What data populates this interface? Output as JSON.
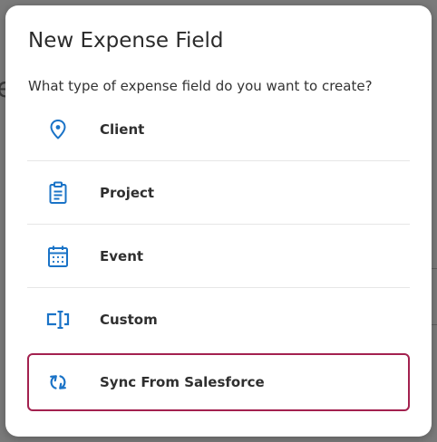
{
  "background": {
    "partial_text": "e"
  },
  "modal": {
    "title": "New Expense Field",
    "prompt": "What type of expense field do you want to create?",
    "accent_color": "#a3214f",
    "icon_color": "#1a73c7",
    "options": [
      {
        "label": "Client",
        "icon": "location-pin-icon",
        "selected": false
      },
      {
        "label": "Project",
        "icon": "clipboard-icon",
        "selected": false
      },
      {
        "label": "Event",
        "icon": "calendar-icon",
        "selected": false
      },
      {
        "label": "Custom",
        "icon": "text-field-icon",
        "selected": false
      },
      {
        "label": "Sync From Salesforce",
        "icon": "sync-icon",
        "selected": true
      }
    ]
  }
}
